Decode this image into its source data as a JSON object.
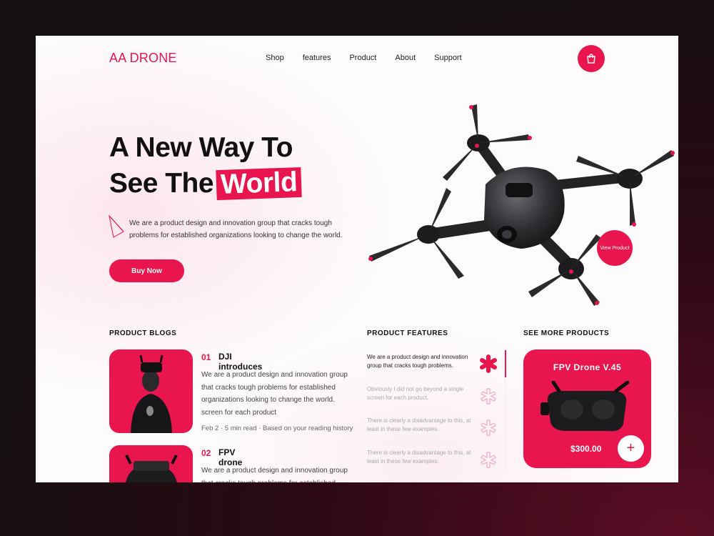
{
  "brand": {
    "logo": "AA DRONE",
    "accent": "#e8154e"
  },
  "nav": {
    "items": [
      "Shop",
      "features",
      "Product",
      "About",
      "Support"
    ]
  },
  "header": {
    "cart_icon": "shopping-bag-icon"
  },
  "hero": {
    "title_line1": "A New Way To",
    "title_line2_plain": "See The",
    "title_line2_highlight": "World",
    "description": "We are a product design and innovation group that cracks tough problems for established organizations looking to change the world.",
    "cta": "Buy Now",
    "badge": "View Product"
  },
  "blogs": {
    "heading": "PRODUCT BLOGS",
    "items": [
      {
        "num": "01",
        "title": "DJI introduces",
        "text": "We are a product design and innovation group that cracks tough problems for established organizations looking to change the world. screen for each product",
        "meta": "Feb 2 · 5 min read · Based on your reading history"
      },
      {
        "num": "02",
        "title": "FPV drone",
        "text": "We are a product design and innovation group that cracks tough problems for established"
      }
    ]
  },
  "features": {
    "heading": "PRODUCT FEATURES",
    "items": [
      {
        "text": "We are a product design and innovation group that cracks tough problems."
      },
      {
        "text": "Obviously I did not go beyond a single screen for each product."
      },
      {
        "text": "There is clearly a disadvantage to this, at least in these few examples."
      },
      {
        "text": "There is clearly a disadvantage to this, at least in these few examples."
      }
    ]
  },
  "more": {
    "heading": "SEE MORE PRODUCTS",
    "card_title": "FPV Drone V.45",
    "price": "$300.00",
    "add_label": "+"
  }
}
